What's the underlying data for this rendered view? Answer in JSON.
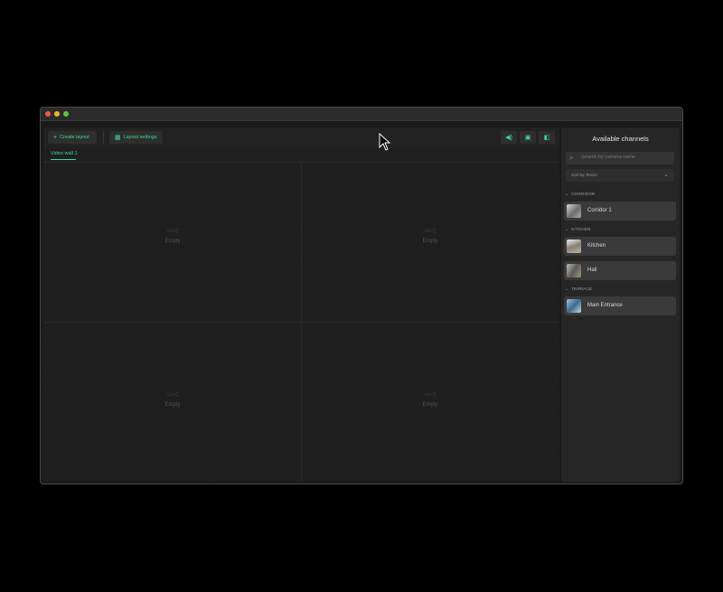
{
  "toolbar": {
    "create_layout": "Create layout",
    "layout_settings": "Layout settings"
  },
  "tabs": [
    "Video wall 1"
  ],
  "grid": {
    "cells": [
      {
        "label": "Empty"
      },
      {
        "label": "Empty"
      },
      {
        "label": "Empty"
      },
      {
        "label": "Empty"
      }
    ]
  },
  "sidebar": {
    "title": "Available channels",
    "search_placeholder": "Search by camera name",
    "sort_label": "Sort by: Room",
    "groups": [
      {
        "name": "CORRIDOR",
        "channels": [
          "Corridor 1"
        ]
      },
      {
        "name": "KITCHEN",
        "channels": [
          "Kitchen",
          "Hall"
        ]
      },
      {
        "name": "TERRACE",
        "channels": [
          "Main Entrance"
        ]
      }
    ]
  },
  "colors": {
    "accent": "#3ddc97",
    "window_bg": "#1a1a1a",
    "sidebar_bg": "#262626",
    "channel_bg": "#3a3a3a"
  }
}
